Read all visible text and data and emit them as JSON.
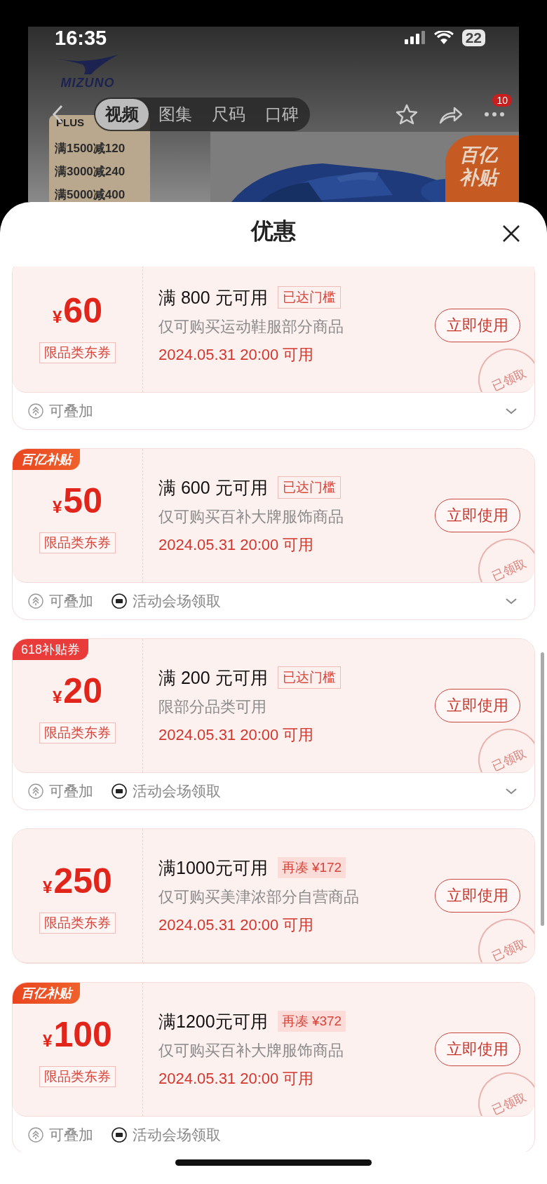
{
  "status_bar": {
    "time": "16:35",
    "battery": "22"
  },
  "product_header": {
    "logo": "MIZUNO",
    "tabs": [
      {
        "label": "视频",
        "selected": true
      },
      {
        "label": "图集",
        "selected": false
      },
      {
        "label": "尺码",
        "selected": false
      },
      {
        "label": "口碑",
        "selected": false
      }
    ],
    "more_badge": "10",
    "promo": {
      "label": "PLUS",
      "lines": [
        "满1500减120",
        "满3000减240",
        "满5000减400"
      ]
    },
    "subsidy_badge": "百亿补贴"
  },
  "sheet": {
    "title": "优惠"
  },
  "coupons": [
    {
      "currency": "¥",
      "amount": "60",
      "category": "限品类东券",
      "title": "满 800 元可用",
      "threshold": {
        "kind": "reached",
        "text": "已达门槛"
      },
      "scope": "仅可购买运动鞋服部分商品",
      "date": "2024.05.31 20:00 可用",
      "button": "立即使用",
      "stamp": "已领取",
      "footer": {
        "items": [
          {
            "kind": "stackable",
            "text": "可叠加"
          }
        ],
        "collapsible": true
      }
    },
    {
      "tag": {
        "kind": "subsidy",
        "text": "百亿补贴"
      },
      "currency": "¥",
      "amount": "50",
      "category": "限品类东券",
      "title": "满 600 元可用",
      "threshold": {
        "kind": "reached",
        "text": "已达门槛"
      },
      "scope": "仅可购买百补大牌服饰商品",
      "date": "2024.05.31 20:00 可用",
      "button": "立即使用",
      "stamp": "已领取",
      "footer": {
        "items": [
          {
            "kind": "stackable",
            "text": "可叠加"
          },
          {
            "kind": "venue",
            "text": "活动会场领取"
          }
        ],
        "collapsible": true
      }
    },
    {
      "tag": {
        "kind": "promo",
        "text": "618补贴券"
      },
      "currency": "¥",
      "amount": "20",
      "category": "限品类东券",
      "title": "满 200 元可用",
      "threshold": {
        "kind": "reached",
        "text": "已达门槛"
      },
      "scope": "限部分品类可用",
      "date": "2024.05.31 20:00 可用",
      "button": "立即使用",
      "stamp": "已领取",
      "footer": {
        "items": [
          {
            "kind": "stackable",
            "text": "可叠加"
          },
          {
            "kind": "venue",
            "text": "活动会场领取"
          }
        ],
        "collapsible": true
      }
    },
    {
      "currency": "¥",
      "amount": "250",
      "category": "限品类东券",
      "title": "满1000元可用",
      "threshold": {
        "kind": "short",
        "text": "再凑 ¥172"
      },
      "scope": "仅可购买美津浓部分自营商品",
      "date": "2024.05.31 20:00 可用",
      "button": "立即使用",
      "stamp": "已领取"
    },
    {
      "tag": {
        "kind": "subsidy",
        "text": "百亿补贴"
      },
      "currency": "¥",
      "amount": "100",
      "category": "限品类东券",
      "title": "满1200元可用",
      "threshold": {
        "kind": "short",
        "text": "再凑 ¥372"
      },
      "scope": "仅可购买百补大牌服饰商品",
      "date": "2024.05.31 20:00 可用",
      "button": "立即使用",
      "stamp": "已领取",
      "footer": {
        "items": [
          {
            "kind": "stackable",
            "text": "可叠加"
          },
          {
            "kind": "venue",
            "text": "活动会场领取"
          }
        ],
        "collapsible": false
      }
    }
  ]
}
